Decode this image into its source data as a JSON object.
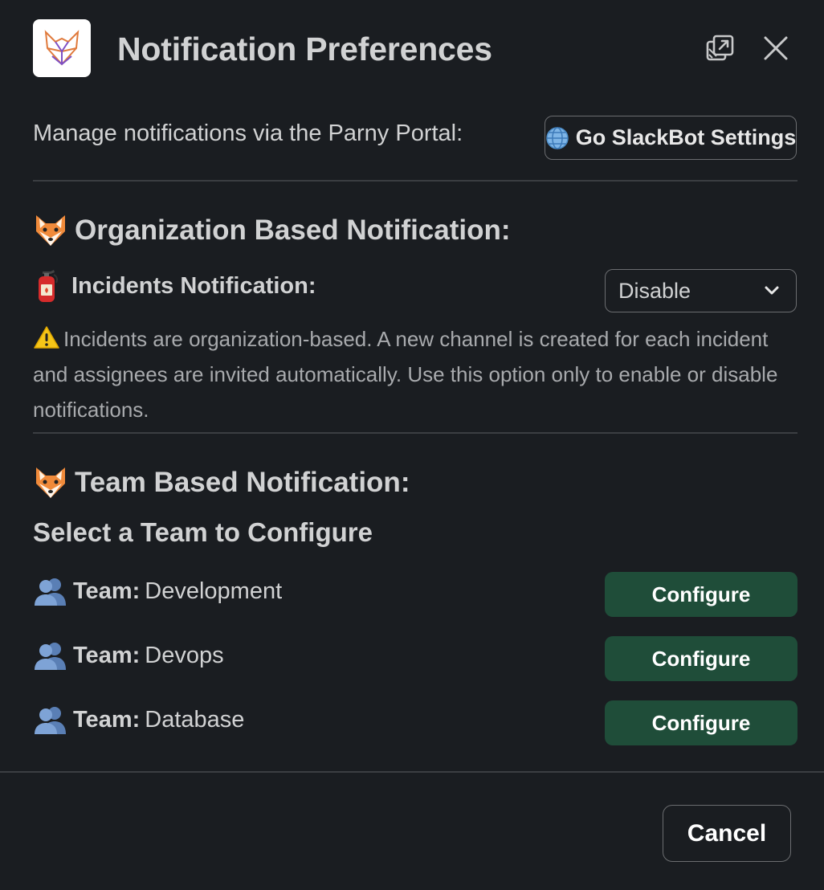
{
  "header": {
    "title": "Notification Preferences",
    "logo_icon": "fox-logo-icon",
    "popout_icon": "popout-icon",
    "close_icon": "close-icon"
  },
  "portal": {
    "text": "Manage notifications via the Parny Portal:",
    "button_label": "Go SlackBot Settings",
    "button_icon": "globe-icon"
  },
  "organization": {
    "heading": "Organization Based Notification:",
    "heading_icon": "fox-face-icon",
    "incidents_label": "Incidents Notification:",
    "incidents_icon": "fire-extinguisher-icon",
    "select_value": "Disable",
    "warning_icon": "warning-icon",
    "warning_text": "Incidents are organization-based. A new channel is created for each incident and assignees are invited automatically. Use this option only to enable or disable notifications."
  },
  "team": {
    "heading": "Team Based Notification:",
    "heading_icon": "fox-face-icon",
    "subheading": "Select a Team to Configure",
    "team_prefix": "Team:",
    "teams": [
      {
        "name": "Development",
        "button_label": "Configure"
      },
      {
        "name": "Devops",
        "button_label": "Configure"
      },
      {
        "name": "Database",
        "button_label": "Configure"
      }
    ],
    "team_icon": "busts-in-silhouette-icon"
  },
  "footer": {
    "cancel_label": "Cancel"
  },
  "colors": {
    "background": "#1a1d21",
    "configure_button": "#1f4d39",
    "border": "#6b6d70",
    "divider": "#3b3e42"
  }
}
